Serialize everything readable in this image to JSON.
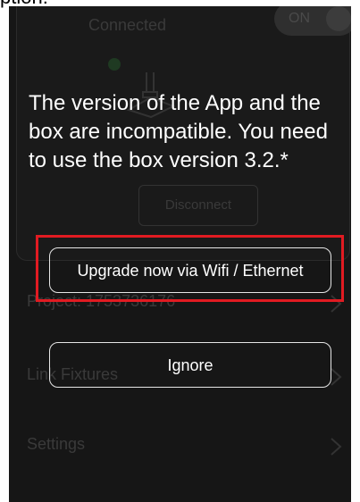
{
  "caption": "ption:",
  "background": {
    "connected_label": "Connected",
    "toggle_label": "ON",
    "disconnect_label": "Disconnect",
    "project_label": "Project: 1753736176",
    "link_fixtures_label": "Link Fixtures",
    "settings_label": "Settings"
  },
  "dialog": {
    "message": "The version of the App and the box are incompatible. You need to use the box version 3.2.*",
    "upgrade_label": "Upgrade now via Wifi / Ethernet",
    "ignore_label": "Ignore"
  },
  "colors": {
    "screen_bg": "#161616",
    "highlight": "#e11b22",
    "button_border": "#e6e6e6"
  }
}
